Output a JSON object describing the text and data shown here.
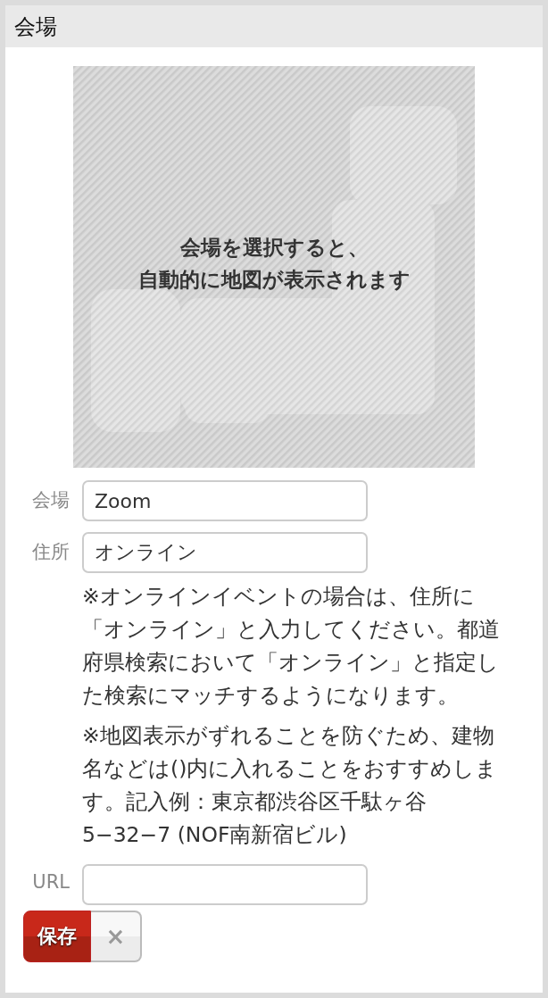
{
  "section": {
    "title": "会場"
  },
  "map": {
    "message_lines": [
      "会場を選択すると、",
      "自動的に地図が表示されます"
    ]
  },
  "fields": [
    {
      "label": "会場",
      "value": "Zoom"
    },
    {
      "label": "住所",
      "value": "オンライン"
    }
  ],
  "notes": [
    "※オンラインイベントの場合は、住所に「オンライン」と入力してください。都道府県検索において「オンライン」と指定した検索にマッチするようになります。",
    "※地図表示がずれることを防ぐため、建物名などは()内に入れることをおすすめします。記入例：東京都渋谷区千駄ヶ谷5−32−7 (NOF南新宿ビル)"
  ],
  "url_field": {
    "label": "URL"
  },
  "buttons": {
    "save": "保存",
    "cancel": "×"
  }
}
